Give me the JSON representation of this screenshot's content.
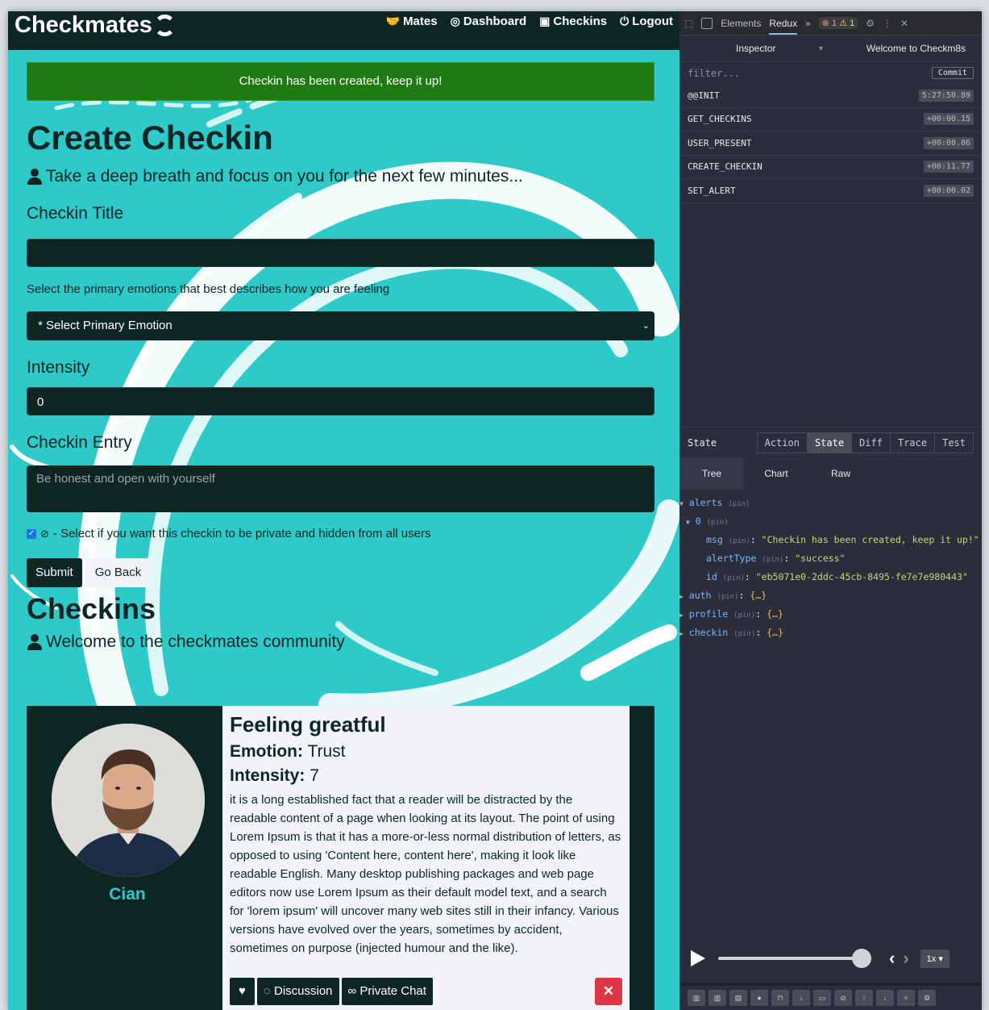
{
  "app": {
    "brand": "Checkmates",
    "nav": [
      {
        "icon": "handshake-icon",
        "glyph": "🤝",
        "label": "Mates"
      },
      {
        "icon": "user-circle-icon",
        "glyph": "◎",
        "label": "Dashboard"
      },
      {
        "icon": "calendar-check-icon",
        "glyph": "▣",
        "label": "Checkins"
      },
      {
        "icon": "power-icon",
        "glyph": "⏻",
        "label": "Logout"
      }
    ],
    "alert": "Checkin has been created, keep it up!",
    "form": {
      "title": "Create Checkin",
      "lead": "Take a deep breath and focus on you for the next few minutes...",
      "title_label": "Checkin Title",
      "title_value": "",
      "emotion_help": "Select the primary emotions that best describes how you are feeling",
      "emotion_value": "* Select Primary Emotion",
      "intensity_label": "Intensity",
      "intensity_value": "0",
      "entry_label": "Checkin Entry",
      "entry_placeholder": "Be honest and open with yourself",
      "private_label": "- Select if you want this checkin to be private and hidden from all users",
      "private_checked": true,
      "submit": "Submit",
      "back": "Go Back"
    },
    "checkins": {
      "title": "Checkins",
      "lead": "Welcome to the checkmates community",
      "card": {
        "user": "Cian",
        "title": "Feeling greatful",
        "emotion_label": "Emotion:",
        "emotion": "Trust",
        "intensity_label": "Intensity:",
        "intensity": "7",
        "text": "it is a long established fact that a reader will be distracted by the readable content of a page when looking at its layout. The point of using Lorem Ipsum is that it has a more-or-less normal distribution of letters, as opposed to using 'Content here, content here', making it look like readable English. Many desktop publishing packages and web page editors now use Lorem Ipsum as their default model text, and a search for 'lorem ipsum' will uncover many web sites still in their infancy. Various versions have evolved over the years, sometimes by accident, sometimes on purpose (injected humour and the like).",
        "discussion": "Discussion",
        "private_chat": "Private Chat",
        "delete": "✕"
      }
    }
  },
  "devtools": {
    "tabs": [
      "Elements",
      "Redux",
      "»"
    ],
    "active_tab": "Redux",
    "errors": "1",
    "warnings": "1",
    "inspector": "Inspector",
    "instance": "Welcome to Checkm8s",
    "filter_placeholder": "filter...",
    "commit": "Commit",
    "actions": [
      {
        "name": "@@INIT",
        "time": "5:27:50.89"
      },
      {
        "name": "GET_CHECKINS",
        "time": "+00:00.15"
      },
      {
        "name": "USER_PRESENT",
        "time": "+00:00.06"
      },
      {
        "name": "CREATE_CHECKIN",
        "time": "+00:11.77"
      },
      {
        "name": "SET_ALERT",
        "time": "+00:00.02"
      }
    ],
    "state_label": "State",
    "state_tabs": [
      "Action",
      "State",
      "Diff",
      "Trace",
      "Test"
    ],
    "active_state_tab": "State",
    "sub_tabs": [
      "Tree",
      "Chart",
      "Raw"
    ],
    "active_sub_tab": "Tree",
    "tree": {
      "alerts": "alerts",
      "pin": "(pin)",
      "index": "0",
      "msg_key": "msg",
      "msg_val": "\"Checkin has been created, keep it up!\"",
      "type_key": "alertType",
      "type_val": "\"success\"",
      "id_key": "id",
      "id_val": "\"eb5071e0-2ddc-45cb-8495-fe7e7e980443\"",
      "auth": "auth",
      "profile": "profile",
      "checkin": "checkin",
      "collapsed": "{…}"
    },
    "speed": "1x"
  }
}
